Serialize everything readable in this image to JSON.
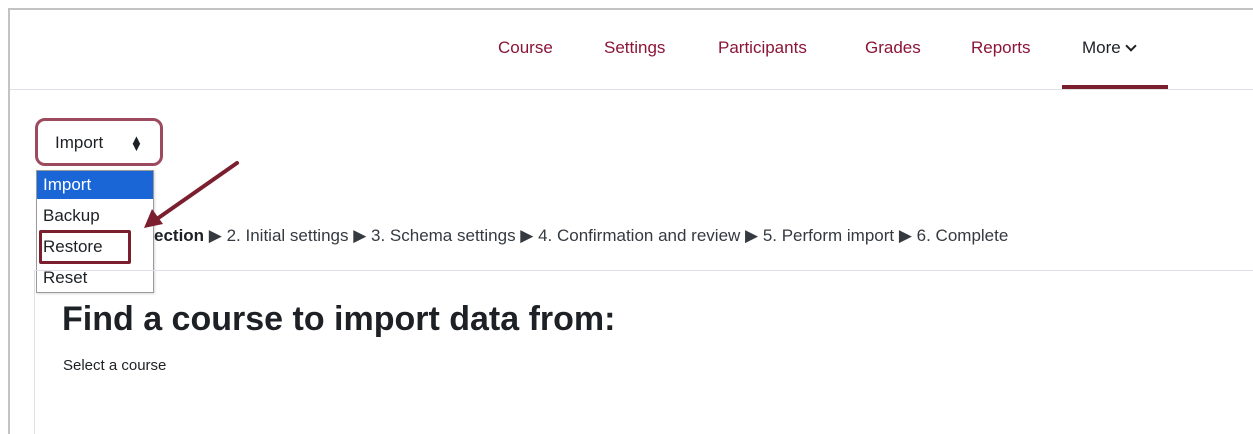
{
  "nav": {
    "items": [
      {
        "label": "Course"
      },
      {
        "label": "Settings"
      },
      {
        "label": "Participants"
      },
      {
        "label": "Grades"
      },
      {
        "label": "Reports"
      },
      {
        "label": "More"
      }
    ],
    "active": "More"
  },
  "select": {
    "current": "Import",
    "options": [
      "Import",
      "Backup",
      "Restore",
      "Reset"
    ],
    "highlighted_option": "Restore"
  },
  "steps": {
    "current": "ection",
    "rest": " ▶ 2. Initial settings ▶ 3. Schema settings ▶ 4. Confirmation and review ▶ 5. Perform import ▶ 6. Complete"
  },
  "page": {
    "title": "Find a course to import data from:",
    "subtitle": "Select a course"
  },
  "colors": {
    "brand": "#8a1538",
    "highlight": "#7b1e2e",
    "selected_option": "#1a66d6"
  }
}
